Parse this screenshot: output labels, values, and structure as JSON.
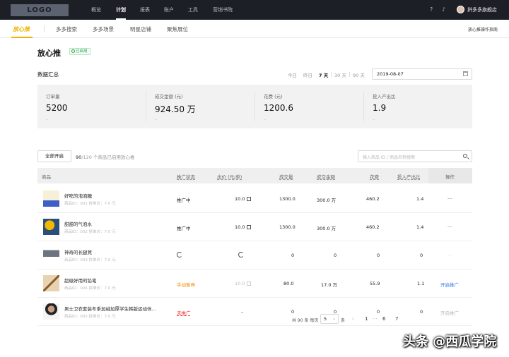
{
  "topbar": {
    "logo": "LOGO",
    "nav": [
      "概览",
      "计划",
      "报表",
      "账户",
      "工具",
      "营销书院"
    ],
    "active_nav": "计划",
    "shop_name": "拼多多旗舰店"
  },
  "subnav": {
    "brand": "放心推",
    "items": [
      "多多搜索",
      "多多场景",
      "明星店铺",
      "聚焦展位"
    ],
    "guide": "放心推操作指南"
  },
  "page": {
    "title": "放心推",
    "status": "已启用",
    "section_title": "数据汇总",
    "date_tabs": [
      "今日",
      "昨日",
      "7 天",
      "30 天",
      "90 天"
    ],
    "active_date_tab": "7 天",
    "date_value": "2019-08-07"
  },
  "metrics": [
    {
      "label": "订单量",
      "value": "5200",
      "sub": "–"
    },
    {
      "label": "成交金额 (元)",
      "value": "924.50 万",
      "sub": "–"
    },
    {
      "label": "花费 (元)",
      "value": "1200.6",
      "sub": "–"
    },
    {
      "label": "投入产出比",
      "value": "1.9",
      "sub": "–"
    }
  ],
  "toolbar": {
    "enable_all": "全部开启",
    "count_enabled": "90",
    "count_total": "/120",
    "count_suffix": " 个商品已启用放心推",
    "search_placeholder": "输入商品 ID / 商品名称搜索"
  },
  "table": {
    "headers": [
      "商品",
      "推广状态",
      "出价 (元/单)",
      "成交量",
      "成交金额",
      "花费",
      "投入产出比",
      "操作"
    ],
    "rows": [
      {
        "name": "好吃的泡泡糖",
        "meta": "商品ID：001  拼单价：7.0 元",
        "status": "推广中",
        "bid": "10.0",
        "volume": "1300.0",
        "amount": "300.0 万",
        "cost": "460.2",
        "roi": "1.4",
        "op": "···"
      },
      {
        "name": "甜甜的气泡水",
        "meta": "商品ID：002  拼单价：7.0 元",
        "status": "推广中",
        "bid": "10.0",
        "volume": "1300.0",
        "amount": "300.0 万",
        "cost": "460.2",
        "roi": "1.4",
        "op": "···"
      },
      {
        "name": "神奇的长腿凳",
        "meta": "商品ID：003  拼单价：7.0 元",
        "status": "",
        "bid": "",
        "volume": "0",
        "amount": "0",
        "cost": "0",
        "roi": "0",
        "op": "···"
      },
      {
        "name": "超级好用的铅笔",
        "meta": "商品ID：004  拼单价：7.0 元",
        "status": "手动暂停",
        "bid": "10.0",
        "volume": "80.0",
        "amount": "17.0 万",
        "cost": "55.9",
        "roi": "1.1",
        "op": "开启推广"
      },
      {
        "name": "男士卫衣套装冬季加绒加厚学生韩版运动休...",
        "meta": "商品ID：005  拼单价：7.0 元",
        "status": "未推广",
        "bid": "–",
        "volume": "0",
        "amount": "0",
        "cost": "0",
        "roi": "0",
        "op": "开启推广"
      }
    ]
  },
  "pagination": {
    "total": "共 90 条 每页",
    "page_size": "5",
    "unit": "条",
    "prev": "‹",
    "pages": [
      "1",
      "···",
      "6",
      "7"
    ]
  },
  "watermark": "头条 @西瓜学院",
  "colors": {
    "accent": "#f0b400",
    "topbar": "#1c1f26",
    "success": "#2aa54c",
    "warning": "#f08a00",
    "danger": "#e33333",
    "link": "#3d7bf0"
  }
}
